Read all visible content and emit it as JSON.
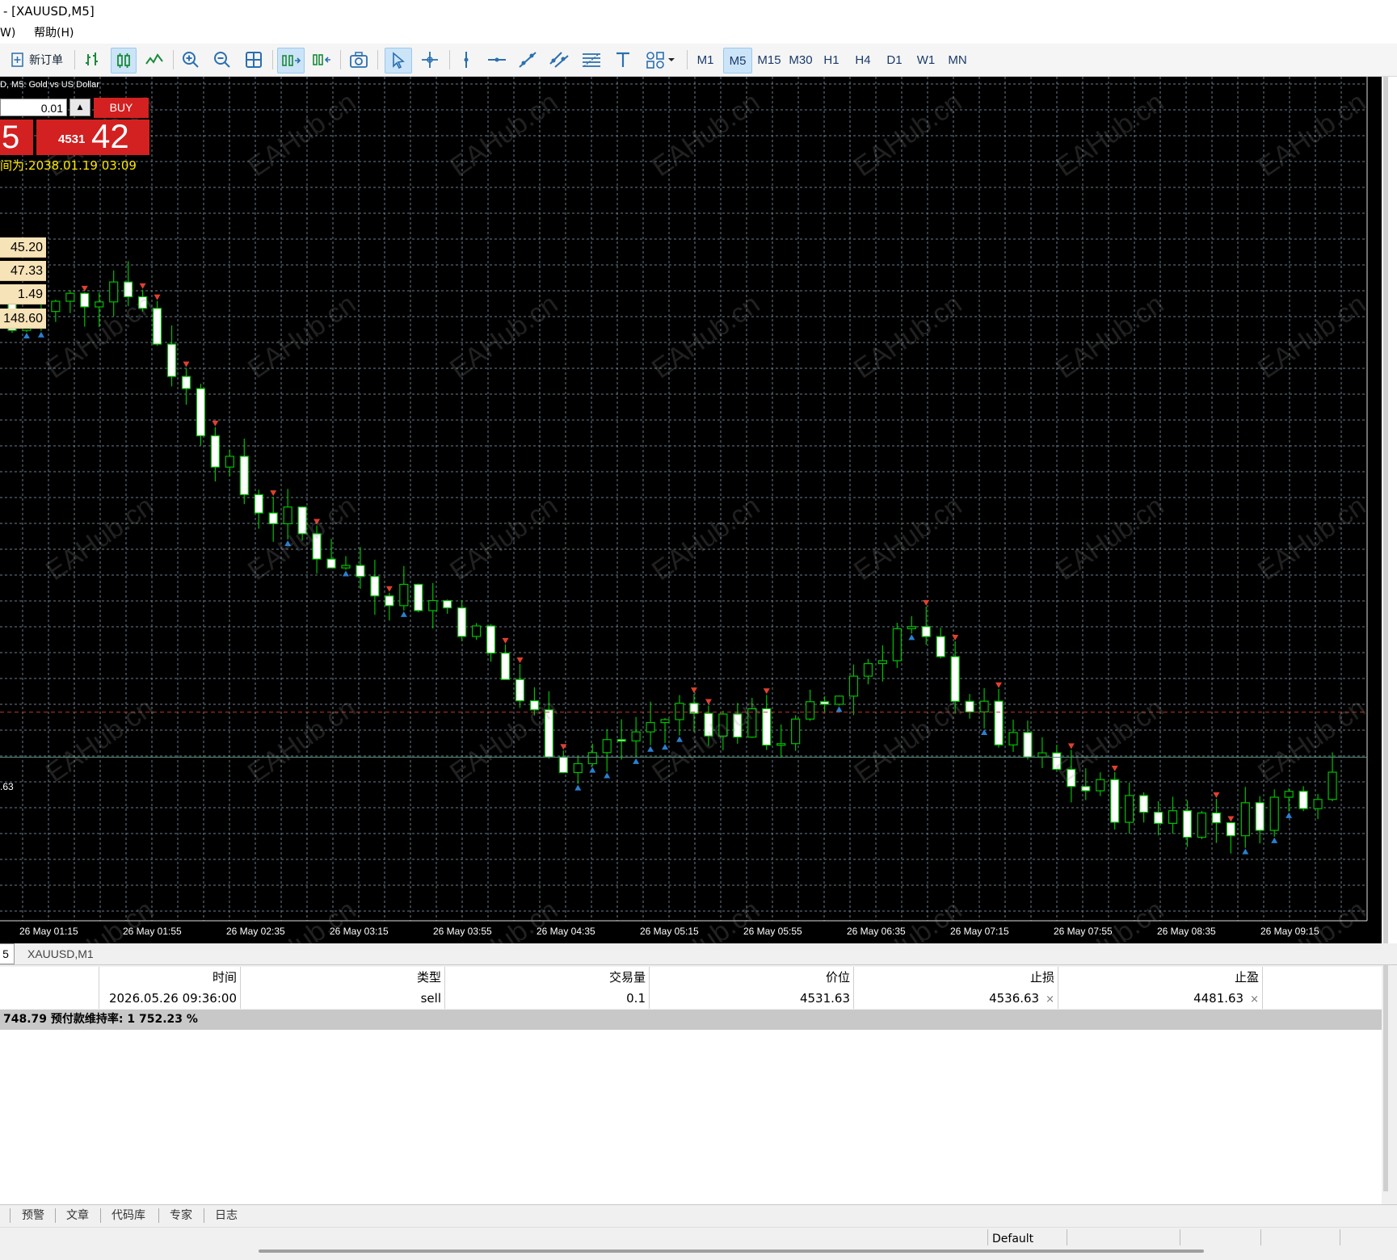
{
  "window": {
    "title": "- [XAUUSD,M5]"
  },
  "menu": {
    "items": [
      "W)",
      "帮助(H)"
    ]
  },
  "toolbar": {
    "new_order_label": "新订单",
    "timeframes": [
      "M1",
      "M5",
      "M15",
      "M30",
      "H1",
      "H4",
      "D1",
      "W1",
      "MN"
    ],
    "active_timeframe": "M5"
  },
  "chart": {
    "caption": "D, M5:  Gold vs US Dollar",
    "trade_panel": {
      "lot": "0.01",
      "buy_label": "BUY",
      "sell_price_big": "5",
      "buy_price_small": "4531",
      "buy_price_big": "42"
    },
    "yellow_text": "间为:2038.01.19 03:09",
    "info_boxes": [
      "45.20",
      "47.33",
      "1.49",
      "148.60"
    ],
    "price_line_label": ".63",
    "x_ticks": [
      "26 May 01:15",
      "26 May 01:55",
      "26 May 02:35",
      "26 May 03:15",
      "26 May 03:55",
      "26 May 04:35",
      "26 May 05:15",
      "26 May 05:55",
      "26 May 06:35",
      "26 May 07:15",
      "26 May 07:55",
      "26 May 08:35",
      "26 May 09:15"
    ],
    "watermark": "EAHub.cn",
    "colors": {
      "background": "#000000",
      "grid": "#6a7d8a",
      "bull": "#00c000",
      "bear_body": "#ffffff",
      "ask_line": "#c0392b",
      "bid_line": "#5a8a7a"
    }
  },
  "chart_data": {
    "type": "candlestick",
    "symbol": "XAUUSD",
    "timeframe": "M5",
    "x": [
      "26 May 01:15",
      "26 May 01:55",
      "26 May 02:35",
      "26 May 03:15",
      "26 May 03:55",
      "26 May 04:35",
      "26 May 05:15",
      "26 May 05:55",
      "26 May 06:35",
      "26 May 07:15",
      "26 May 07:55",
      "26 May 08:35",
      "26 May 09:15"
    ],
    "close_at_tick": [
      4562,
      4566,
      4551,
      4545,
      4542,
      4531,
      4535,
      4533,
      4541,
      4532,
      4528,
      4527,
      4531
    ],
    "bid_line": 4531.63
  },
  "tabs": {
    "current": "5",
    "other": "XAUUSD,M1"
  },
  "trade_table": {
    "headers": [
      "时间",
      "类型",
      "交易量",
      "价位",
      "止损",
      "止盈"
    ],
    "row": {
      "time": "2026.05.26 09:36:00",
      "type": "sell",
      "volume": "0.1",
      "price": "4531.63",
      "sl": "4536.63",
      "tp": "4481.63",
      "close": "×"
    }
  },
  "summary": "748.79  预付款维持率: 1 752.23 %",
  "bottom_tabs": [
    "预警",
    "文章",
    "代码库",
    "专家",
    "日志"
  ],
  "status": {
    "profile": "Default"
  }
}
